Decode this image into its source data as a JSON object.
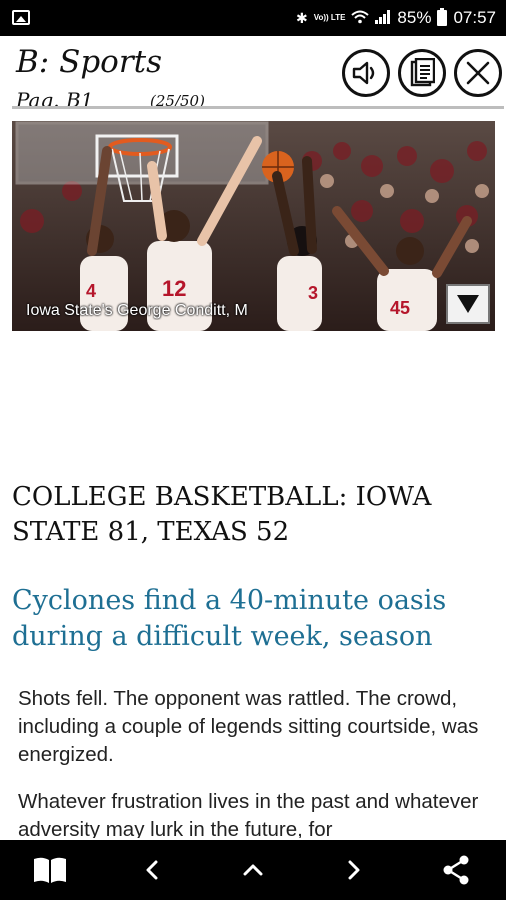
{
  "status_bar": {
    "battery": "85%",
    "time": "07:57",
    "volte": "Vo)) LTE"
  },
  "header": {
    "section_title": "B: Sports",
    "page_label": "Pag. B1",
    "page_count": "(25/50)",
    "buttons": {
      "audio": "speaker-icon",
      "copy": "clipboard-icon",
      "close": "close-icon"
    }
  },
  "photo": {
    "caption": "Iowa State's George Conditt, M",
    "players": [
      "4",
      "12",
      "3",
      "45"
    ],
    "toggle_icon": "triangle-down-icon"
  },
  "article": {
    "kicker": "COLLEGE BASKETBALL: IOWA STATE 81, TEXAS 52",
    "headline": "Cyclones find a 40-minute oasis during a difficult week, season",
    "paragraphs": [
      "Shots fell. The opponent was rattled. The crowd, including a couple of legends sitting courtside, was energized.",
      "Whatever frustration lives in the past and whatever adversity may lurk in the future, for"
    ]
  },
  "bottom_bar": {
    "icons": [
      "open-book-icon",
      "chevron-left-icon",
      "chevron-up-icon",
      "chevron-right-icon",
      "share-icon"
    ]
  },
  "colors": {
    "headline": "#1e6f93",
    "bars": "#000000",
    "jersey": "#f4ede8",
    "jersey_number": "#b5162b"
  }
}
